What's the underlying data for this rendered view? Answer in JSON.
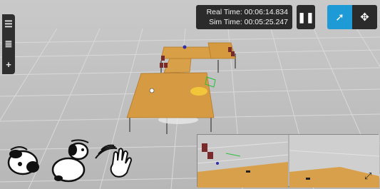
{
  "toolbar": {
    "items": [
      {
        "name": "menu",
        "glyph": "☰"
      },
      {
        "name": "layers",
        "glyph": "≣"
      },
      {
        "name": "add",
        "glyph": "+"
      }
    ]
  },
  "time_panel": {
    "real_time": "Real Time: 00:06:14.834",
    "sim_time": "Sim Time: 00:05:25.247"
  },
  "controls": {
    "pause_glyph": "❚❚",
    "select_glyph": "➚",
    "translate_glyph": "✥"
  },
  "camera": {
    "expand_glyph": "⤢"
  },
  "colors": {
    "grid_bg": "#c2c2c2",
    "grid_line": "#d8d8d8",
    "table_top": "#d99a3e",
    "accent_blue": "#1e9ad6",
    "panel_dark": "#2b2b2b"
  }
}
